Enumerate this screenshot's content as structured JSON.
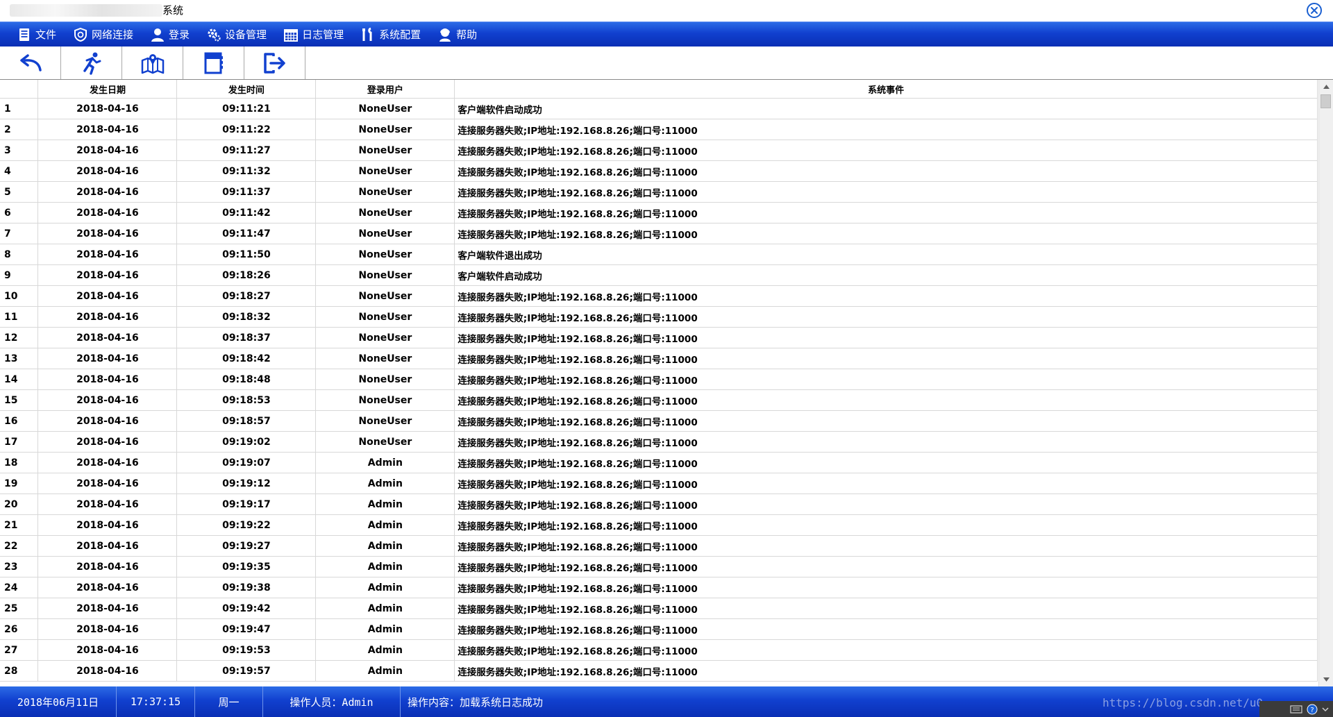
{
  "window": {
    "title_suffix": "系统"
  },
  "menu": [
    {
      "label": "文件",
      "icon": "file-icon"
    },
    {
      "label": "网络连接",
      "icon": "network-icon"
    },
    {
      "label": "登录",
      "icon": "user-icon"
    },
    {
      "label": "设备管理",
      "icon": "gear-icon"
    },
    {
      "label": "日志管理",
      "icon": "calendar-icon"
    },
    {
      "label": "系统配置",
      "icon": "tools-icon"
    },
    {
      "label": "帮助",
      "icon": "help-icon"
    }
  ],
  "toolbar": [
    {
      "icon": "back-arrow-icon"
    },
    {
      "icon": "running-man-icon"
    },
    {
      "icon": "map-icon"
    },
    {
      "icon": "notebook-icon"
    },
    {
      "icon": "exit-icon"
    }
  ],
  "table": {
    "columns": [
      "",
      "发生日期",
      "发生时间",
      "登录用户",
      "系统事件"
    ],
    "rows": [
      [
        "1",
        "2018-04-16",
        "09:11:21",
        "NoneUser",
        "客户端软件启动成功"
      ],
      [
        "2",
        "2018-04-16",
        "09:11:22",
        "NoneUser",
        "连接服务器失败;IP地址:192.168.8.26;端口号:11000"
      ],
      [
        "3",
        "2018-04-16",
        "09:11:27",
        "NoneUser",
        "连接服务器失败;IP地址:192.168.8.26;端口号:11000"
      ],
      [
        "4",
        "2018-04-16",
        "09:11:32",
        "NoneUser",
        "连接服务器失败;IP地址:192.168.8.26;端口号:11000"
      ],
      [
        "5",
        "2018-04-16",
        "09:11:37",
        "NoneUser",
        "连接服务器失败;IP地址:192.168.8.26;端口号:11000"
      ],
      [
        "6",
        "2018-04-16",
        "09:11:42",
        "NoneUser",
        "连接服务器失败;IP地址:192.168.8.26;端口号:11000"
      ],
      [
        "7",
        "2018-04-16",
        "09:11:47",
        "NoneUser",
        "连接服务器失败;IP地址:192.168.8.26;端口号:11000"
      ],
      [
        "8",
        "2018-04-16",
        "09:11:50",
        "NoneUser",
        "客户端软件退出成功"
      ],
      [
        "9",
        "2018-04-16",
        "09:18:26",
        "NoneUser",
        "客户端软件启动成功"
      ],
      [
        "10",
        "2018-04-16",
        "09:18:27",
        "NoneUser",
        "连接服务器失败;IP地址:192.168.8.26;端口号:11000"
      ],
      [
        "11",
        "2018-04-16",
        "09:18:32",
        "NoneUser",
        "连接服务器失败;IP地址:192.168.8.26;端口号:11000"
      ],
      [
        "12",
        "2018-04-16",
        "09:18:37",
        "NoneUser",
        "连接服务器失败;IP地址:192.168.8.26;端口号:11000"
      ],
      [
        "13",
        "2018-04-16",
        "09:18:42",
        "NoneUser",
        "连接服务器失败;IP地址:192.168.8.26;端口号:11000"
      ],
      [
        "14",
        "2018-04-16",
        "09:18:48",
        "NoneUser",
        "连接服务器失败;IP地址:192.168.8.26;端口号:11000"
      ],
      [
        "15",
        "2018-04-16",
        "09:18:53",
        "NoneUser",
        "连接服务器失败;IP地址:192.168.8.26;端口号:11000"
      ],
      [
        "16",
        "2018-04-16",
        "09:18:57",
        "NoneUser",
        "连接服务器失败;IP地址:192.168.8.26;端口号:11000"
      ],
      [
        "17",
        "2018-04-16",
        "09:19:02",
        "NoneUser",
        "连接服务器失败;IP地址:192.168.8.26;端口号:11000"
      ],
      [
        "18",
        "2018-04-16",
        "09:19:07",
        "Admin",
        "连接服务器失败;IP地址:192.168.8.26;端口号:11000"
      ],
      [
        "19",
        "2018-04-16",
        "09:19:12",
        "Admin",
        "连接服务器失败;IP地址:192.168.8.26;端口号:11000"
      ],
      [
        "20",
        "2018-04-16",
        "09:19:17",
        "Admin",
        "连接服务器失败;IP地址:192.168.8.26;端口号:11000"
      ],
      [
        "21",
        "2018-04-16",
        "09:19:22",
        "Admin",
        "连接服务器失败;IP地址:192.168.8.26;端口号:11000"
      ],
      [
        "22",
        "2018-04-16",
        "09:19:27",
        "Admin",
        "连接服务器失败;IP地址:192.168.8.26;端口号:11000"
      ],
      [
        "23",
        "2018-04-16",
        "09:19:35",
        "Admin",
        "连接服务器失败;IP地址:192.168.8.26;端口号:11000"
      ],
      [
        "24",
        "2018-04-16",
        "09:19:38",
        "Admin",
        "连接服务器失败;IP地址:192.168.8.26;端口号:11000"
      ],
      [
        "25",
        "2018-04-16",
        "09:19:42",
        "Admin",
        "连接服务器失败;IP地址:192.168.8.26;端口号:11000"
      ],
      [
        "26",
        "2018-04-16",
        "09:19:47",
        "Admin",
        "连接服务器失败;IP地址:192.168.8.26;端口号:11000"
      ],
      [
        "27",
        "2018-04-16",
        "09:19:53",
        "Admin",
        "连接服务器失败;IP地址:192.168.8.26;端口号:11000"
      ],
      [
        "28",
        "2018-04-16",
        "09:19:57",
        "Admin",
        "连接服务器失败;IP地址:192.168.8.26;端口号:11000"
      ]
    ]
  },
  "status": {
    "date": "2018年06月11日",
    "time": "17:37:15",
    "weekday": "周一",
    "operator": "操作人员：Admin",
    "action": "操作内容：加载系统日志成功"
  },
  "watermark": "https://blog.csdn.net/u0",
  "colors": {
    "bar_blue": "#1140cf",
    "accent_blue": "#1a5fd1"
  }
}
